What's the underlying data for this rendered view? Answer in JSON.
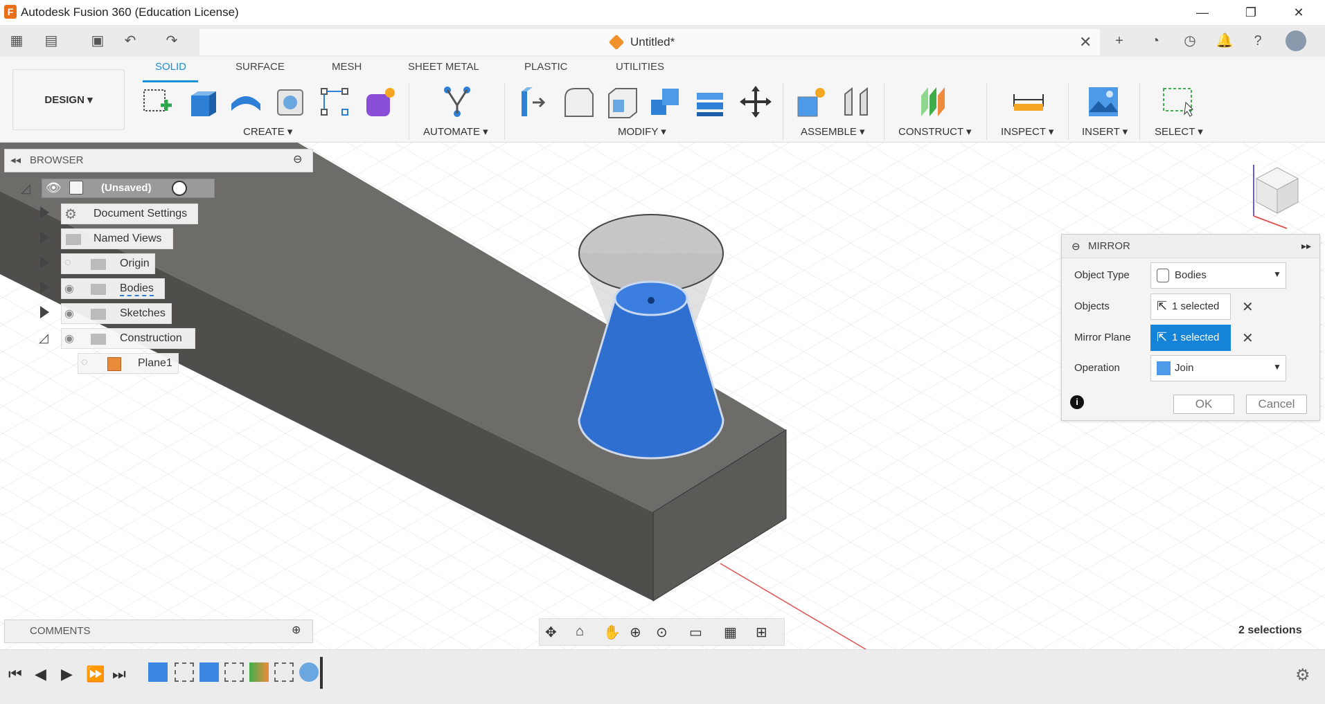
{
  "window": {
    "title": "Autodesk Fusion 360 (Education License)",
    "minimize": "—",
    "restore": "❐",
    "close": "✕"
  },
  "document": {
    "title": "Untitled*",
    "close": "✕"
  },
  "ribbon": {
    "workspace": "DESIGN ▾",
    "tabs": [
      "SOLID",
      "SURFACE",
      "MESH",
      "SHEET METAL",
      "PLASTIC",
      "UTILITIES"
    ],
    "active_tab": "SOLID",
    "groups": [
      "CREATE ▾",
      "AUTOMATE ▾",
      "MODIFY ▾",
      "ASSEMBLE ▾",
      "CONSTRUCT ▾",
      "INSPECT ▾",
      "INSERT ▾",
      "SELECT ▾"
    ]
  },
  "browser": {
    "header": "BROWSER",
    "root": "(Unsaved)",
    "items": [
      "Document Settings",
      "Named Views",
      "Origin",
      "Bodies",
      "Sketches",
      "Construction"
    ],
    "child": "Plane1"
  },
  "comments": {
    "header": "COMMENTS"
  },
  "mirror_dialog": {
    "title": "MIRROR",
    "object_type_label": "Object Type",
    "object_type_value": "Bodies",
    "objects_label": "Objects",
    "objects_value": "1 selected",
    "mirror_plane_label": "Mirror Plane",
    "mirror_plane_value": "1 selected",
    "operation_label": "Operation",
    "operation_value": "Join",
    "ok": "OK",
    "cancel": "Cancel"
  },
  "status": {
    "selections": "2 selections"
  },
  "colors": {
    "accent": "#1a8fd8",
    "selected_field": "#1584d8",
    "body": "#5b5b58",
    "cone": "#2f6fd0"
  }
}
